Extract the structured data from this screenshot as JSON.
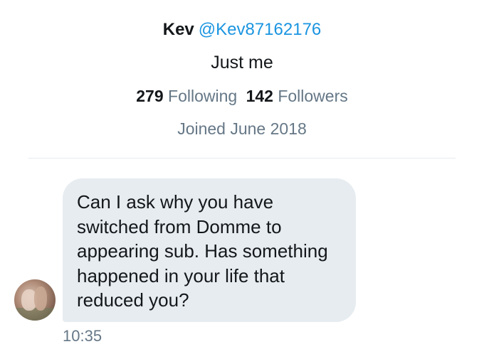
{
  "profile": {
    "name": "Kev",
    "handle": "@Kev87162176",
    "bio": "Just me",
    "following_count": "279",
    "following_label": "Following",
    "followers_count": "142",
    "followers_label": "Followers",
    "joined": "Joined June 2018"
  },
  "conversation": {
    "message": "Can I ask why you have\nswitched from Domme to\nappearing sub. Has something\nhappened in your life that\nreduced you?",
    "time": "10:35"
  },
  "colors": {
    "handle": "#1b95e0",
    "secondary_text": "#657786",
    "bubble": "#e6ecf0"
  }
}
